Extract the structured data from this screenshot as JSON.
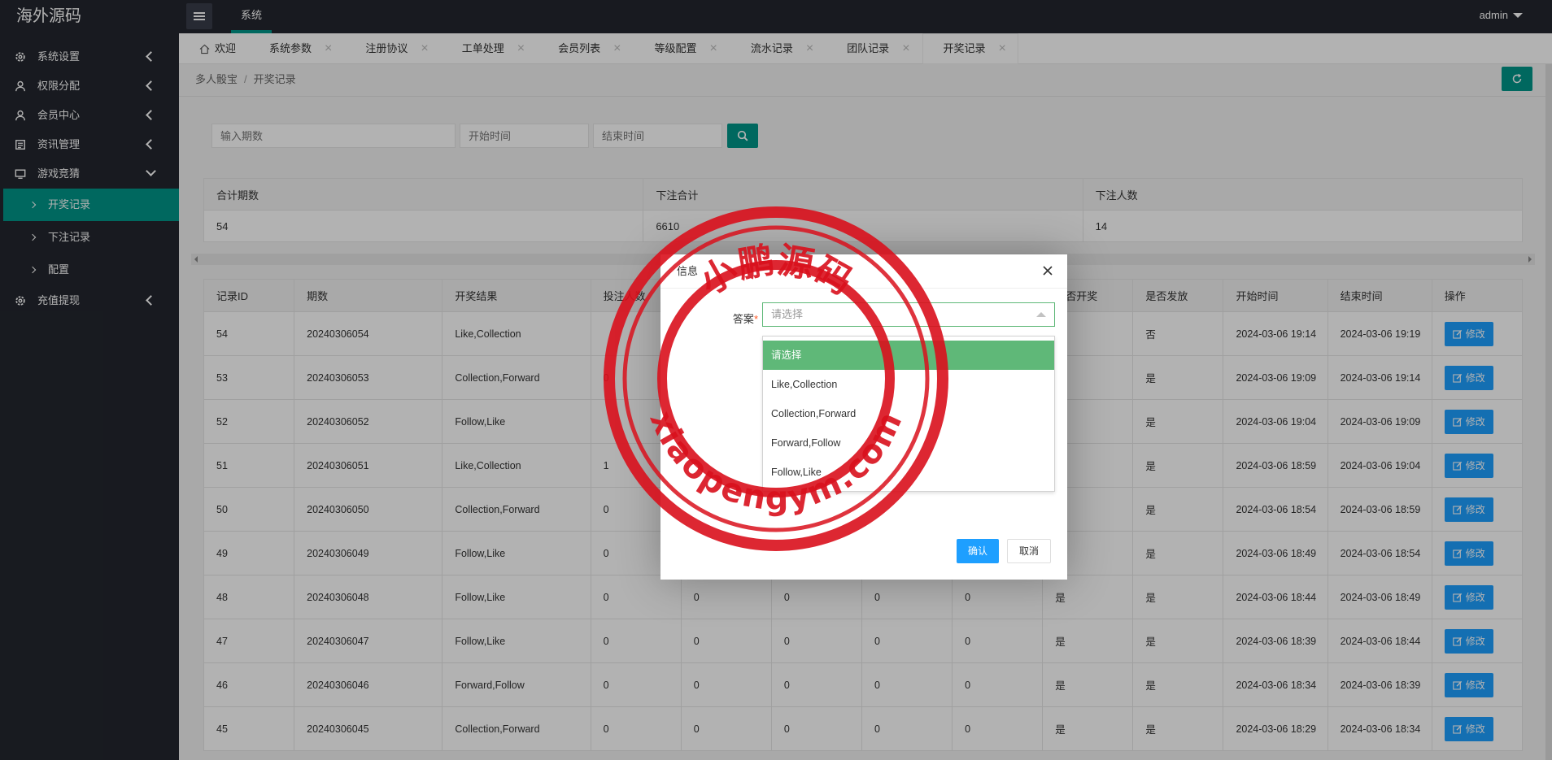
{
  "app": {
    "logo": "海外源码",
    "user": "admin"
  },
  "top_nav": [
    {
      "label": "系统"
    }
  ],
  "sidebar": {
    "items": [
      {
        "label": "系统设置",
        "icon": "gear-icon"
      },
      {
        "label": "权限分配",
        "icon": "user-icon"
      },
      {
        "label": "会员中心",
        "icon": "user-icon"
      },
      {
        "label": "资讯管理",
        "icon": "news-icon"
      },
      {
        "label": "游戏竞猜",
        "icon": "monitor-icon"
      }
    ],
    "sub_items": [
      {
        "label": "开奖记录",
        "active": true
      },
      {
        "label": "下注记录"
      },
      {
        "label": "配置"
      }
    ],
    "after": [
      {
        "label": "充值提现",
        "icon": "gear-icon"
      }
    ]
  },
  "tabs": [
    {
      "label": "欢迎"
    },
    {
      "label": "系统参数"
    },
    {
      "label": "注册协议"
    },
    {
      "label": "工单处理"
    },
    {
      "label": "会员列表"
    },
    {
      "label": "等级配置"
    },
    {
      "label": "流水记录"
    },
    {
      "label": "团队记录"
    },
    {
      "label": "开奖记录",
      "active": true
    }
  ],
  "breadcrumb": {
    "parent": "多人骰宝",
    "sep": "/",
    "current": "开奖记录"
  },
  "filters": {
    "period_placeholder": "输入期数",
    "start_placeholder": "开始时间",
    "end_placeholder": "结束时间"
  },
  "summary": {
    "headers": [
      "合计期数",
      "下注合计",
      "下注人数"
    ],
    "values": [
      "54",
      "6610",
      "14"
    ]
  },
  "table": {
    "headers": [
      "记录ID",
      "期数",
      "开奖结果",
      "投注人数",
      "",
      "",
      "",
      "",
      "是否开奖",
      "是否发放",
      "开始时间",
      "结束时间",
      "操作"
    ],
    "edit_label": "修改",
    "rows": [
      [
        "54",
        "20240306054",
        "Like,Collection",
        "",
        "",
        "",
        "",
        "",
        "",
        "否",
        "2024-03-06 19:14",
        "2024-03-06 19:19"
      ],
      [
        "53",
        "20240306053",
        "Collection,Forward",
        "0",
        "",
        "",
        "",
        "",
        "",
        "是",
        "2024-03-06 19:09",
        "2024-03-06 19:14"
      ],
      [
        "52",
        "20240306052",
        "Follow,Like",
        "",
        "",
        "",
        "",
        "",
        "",
        "是",
        "2024-03-06 19:04",
        "2024-03-06 19:09"
      ],
      [
        "51",
        "20240306051",
        "Like,Collection",
        "1",
        "",
        "",
        "",
        "",
        "",
        "是",
        "2024-03-06 18:59",
        "2024-03-06 19:04"
      ],
      [
        "50",
        "20240306050",
        "Collection,Forward",
        "0",
        "",
        "",
        "",
        "",
        "",
        "是",
        "2024-03-06 18:54",
        "2024-03-06 18:59"
      ],
      [
        "49",
        "20240306049",
        "Follow,Like",
        "0",
        "",
        "",
        "",
        "",
        "",
        "是",
        "2024-03-06 18:49",
        "2024-03-06 18:54"
      ],
      [
        "48",
        "20240306048",
        "Follow,Like",
        "0",
        "0",
        "0",
        "0",
        "0",
        "是",
        "是",
        "2024-03-06 18:44",
        "2024-03-06 18:49"
      ],
      [
        "47",
        "20240306047",
        "Follow,Like",
        "0",
        "0",
        "0",
        "0",
        "0",
        "是",
        "是",
        "2024-03-06 18:39",
        "2024-03-06 18:44"
      ],
      [
        "46",
        "20240306046",
        "Forward,Follow",
        "0",
        "0",
        "0",
        "0",
        "0",
        "是",
        "是",
        "2024-03-06 18:34",
        "2024-03-06 18:39"
      ],
      [
        "45",
        "20240306045",
        "Collection,Forward",
        "0",
        "0",
        "0",
        "0",
        "0",
        "是",
        "是",
        "2024-03-06 18:29",
        "2024-03-06 18:34"
      ]
    ]
  },
  "dialog": {
    "title": "信息",
    "field_label": "答案",
    "required_mark": "*",
    "select_placeholder": "请选择",
    "options": [
      "请选择",
      "Like,Collection",
      "Collection,Forward",
      "Forward,Follow",
      "Follow,Like"
    ],
    "ok_label": "确认",
    "cancel_label": "取消"
  },
  "watermark": {
    "top_text": "小鹏源码",
    "bottom_text": "xiaopengym.com",
    "color": "#d9101c"
  },
  "colors": {
    "accent": "#009688",
    "blue": "#1e9fff",
    "green": "#5fb878",
    "dark": "#23262e"
  }
}
